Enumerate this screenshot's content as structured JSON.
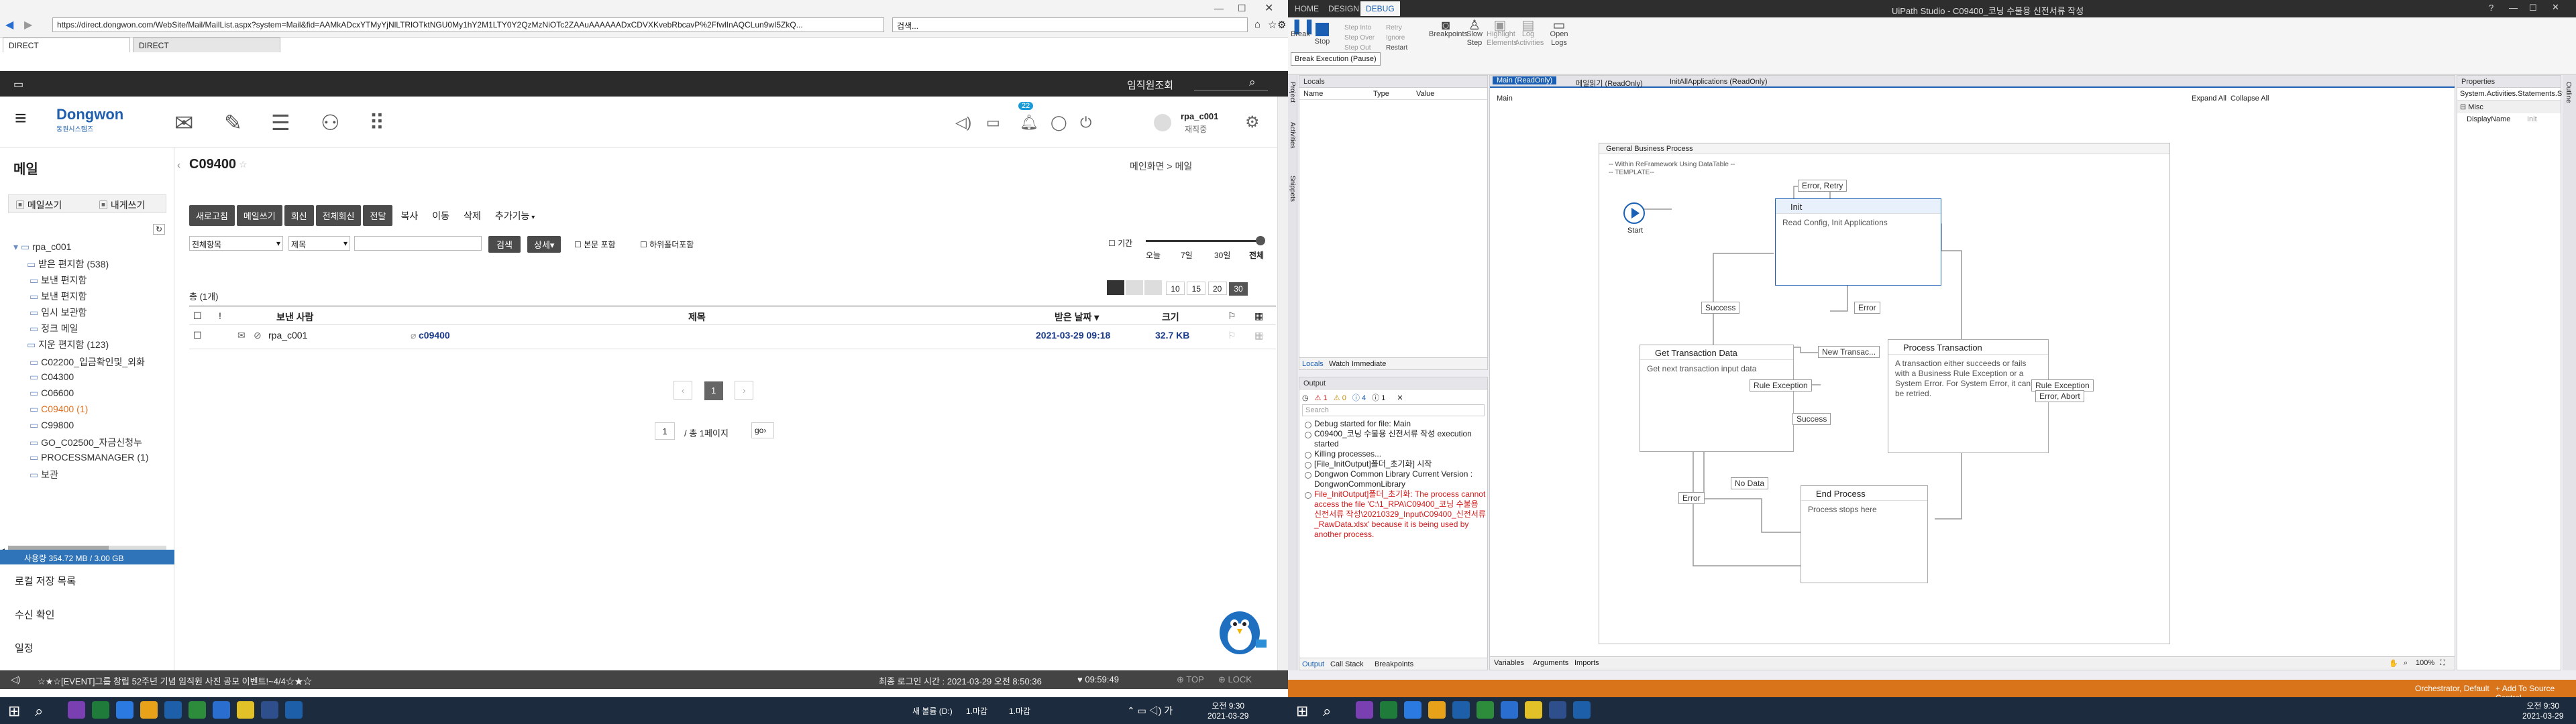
{
  "browser": {
    "url": "https://direct.dongwon.com/WebSite/Mail/MailList.aspx?system=Mail&fid=AAMkADcxYTMyYjNlLTRlOTktNGU0My1hY2M1LTY0Y2QzMzNiOTc2ZAAuAAAAAADxCDVXKvebRbcavP%2FfwlInAQCLun9wI5ZkQ...",
    "search_placeholder": "검색...",
    "tabs": [
      "DIRECT",
      "DIRECT"
    ]
  },
  "mail": {
    "gnb_search_label": "임직원조회",
    "logo_text": "Dongwon",
    "logo_sub": "동원시스템즈",
    "notification_count": "22",
    "user_id": "rpa_c001",
    "user_status": "재직중",
    "section_title": "메일",
    "write_btn": "메일쓰기",
    "self_btn": "내게쓰기",
    "folders": [
      {
        "name": "rpa_c001",
        "count": ""
      },
      {
        "name": "받은 편지함",
        "count": "(538)"
      },
      {
        "name": "보낸 편지함",
        "count": ""
      },
      {
        "name": "보낸 편지함",
        "count": ""
      },
      {
        "name": "임시 보관함",
        "count": ""
      },
      {
        "name": "정크 메일",
        "count": ""
      },
      {
        "name": "지운 편지함",
        "count": "(123)"
      },
      {
        "name": "C02200_입금확인및_외화",
        "count": ""
      },
      {
        "name": "C04300",
        "count": ""
      },
      {
        "name": "C06600",
        "count": ""
      },
      {
        "name": "C09400",
        "count": "(1)"
      },
      {
        "name": "C99800",
        "count": ""
      },
      {
        "name": "GO_C02500_자금신청누",
        "count": ""
      },
      {
        "name": "PROCESSMANAGER",
        "count": "(1)"
      },
      {
        "name": "보관",
        "count": ""
      }
    ],
    "quota": "사용량 354.72 MB / 3.00 GB",
    "side_links": [
      "로컬 저장 목록",
      "수신 확인",
      "일정"
    ],
    "page_title": "C09400",
    "breadcrumb": "메인화면 > 메일",
    "toolbar": [
      "새로고침",
      "메일쓰기",
      "회신",
      "전체회신",
      "전달"
    ],
    "toolbar_plain": [
      "복사",
      "이동",
      "삭제",
      "추가기능"
    ],
    "filter_all": "전체항목",
    "filter_subject": "제목",
    "search_btn": "검색",
    "detail_btn": "상세",
    "chk_body": "본문 포함",
    "chk_sub": "하위폴더포함",
    "period_label": "기간",
    "period_ticks": [
      "오늘",
      "7일",
      "30일",
      "전체"
    ],
    "total": "총 (1개)",
    "page_sizes": [
      "10",
      "15",
      "20",
      "30"
    ],
    "columns": [
      "보낸 사람",
      "제목",
      "받은 날짜",
      "크기"
    ],
    "rows": [
      {
        "sender": "rpa_c001",
        "subject": "c09400",
        "date": "2021-03-29 09:18",
        "size": "32.7 KB"
      }
    ],
    "page_num": "1",
    "page_total": "/ 총 1페이지",
    "page_input": "1",
    "go": "go",
    "status_marquee": "☆★☆[EVENT]그룹 창립 52주년 기념 임직원 사진 공모 이벤트!~4/4☆★☆",
    "last_login": "최종 로그인 시간 : 2021-03-29 오전 8:50:36",
    "timer": "09:59:49",
    "top": "TOP",
    "lock": "LOCK"
  },
  "studio": {
    "title": "UiPath Studio - C09400_코닝 수불용 신전서류 작성",
    "ribbon_tabs": [
      "HOME",
      "DESIGN",
      "DEBUG"
    ],
    "ribbon_btns": [
      "Break",
      "Stop",
      "Step Into",
      "Step Over",
      "Step Out",
      "Retry",
      "Ignore",
      "Restart",
      "Breakpoints",
      "Slow Step",
      "Highlight Elements",
      "Log Activities",
      "Open Logs"
    ],
    "tooltip": "Break Execution (Pause)",
    "left_rail": [
      "Project",
      "Activities",
      "Snippets"
    ],
    "locals_title": "Locals",
    "locals_cols": [
      "Name",
      "Type",
      "Value"
    ],
    "locals_tabs": [
      "Locals",
      "Watch",
      "Immediate"
    ],
    "output_title": "Output",
    "output_counts": [
      "1",
      "0",
      "4",
      "1"
    ],
    "output_search": "Search",
    "output_lines": [
      {
        "text": "Debug started for file: Main",
        "err": false
      },
      {
        "text": "C09400_코닝 수불용 신전서류 작성 execution started",
        "err": false
      },
      {
        "text": "Killing processes...",
        "err": false
      },
      {
        "text": "[File_InitOutput]폴더_초기화] 시작",
        "err": false
      },
      {
        "text": "Dongwon Common Library Current Version : DongwonCommonLibrary",
        "err": false
      },
      {
        "text": "File_InitOutput]폴더_초기화: The process cannot access the file 'C:\\1_RPA\\C09400_코닝 수불용 신전서류 작성\\20210329_Input\\C09400_신전서류_RawData.xlsx' because it is being used by another process.",
        "err": true
      }
    ],
    "output_tabs": [
      "Output",
      "Call Stack",
      "Breakpoints"
    ],
    "doc_tabs": [
      "Main (ReadOnly)",
      "메일읽기 (ReadOnly)",
      "InitAllApplications (ReadOnly)"
    ],
    "crumb": "Main",
    "expand_all": "Expand All",
    "collapse_all": "Collapse All",
    "state_machine": "General Business Process",
    "sm_note": "-- Within ReFramework Using DataTable --\n-- TEMPLATE--",
    "start_label": "Start",
    "states": [
      {
        "title": "Init",
        "body": "Read Config, Init Applications"
      },
      {
        "title": "Get Transaction Data",
        "body": "Get next transaction input data"
      },
      {
        "title": "Process Transaction",
        "body": "A transaction either succeeds or fails with a Business Rule Exception or a System Error. For System Error, it can be retried."
      },
      {
        "title": "End Process",
        "body": "Process stops here"
      }
    ],
    "transitions": [
      "Error, Retry",
      "Success",
      "Error",
      "New Transac...",
      "Rule Exception",
      "Success",
      "Rule Exception",
      "Error, Abort",
      "Error",
      "No Data"
    ],
    "bottom_tabs": [
      "Variables",
      "Arguments",
      "Imports"
    ],
    "zoom": "100%",
    "properties_title": "Properties",
    "properties_class": "System.Activities.Statements.State",
    "prop_group": "Misc",
    "prop_key": "DisplayName",
    "prop_val": "Init",
    "outline_label": "Outline",
    "statusbar_left": "Orchestrator, Default",
    "statusbar_right": "Add To Source Control"
  },
  "taskbar": {
    "left_time": "오전 9:30",
    "left_date": "2021-03-29",
    "right_time": "오전 9:30",
    "right_date": "2021-03-29",
    "tray_text": "새 볼륨 (D:)",
    "tray_text2": "1.마감",
    "tray_text3": "1.마감"
  }
}
